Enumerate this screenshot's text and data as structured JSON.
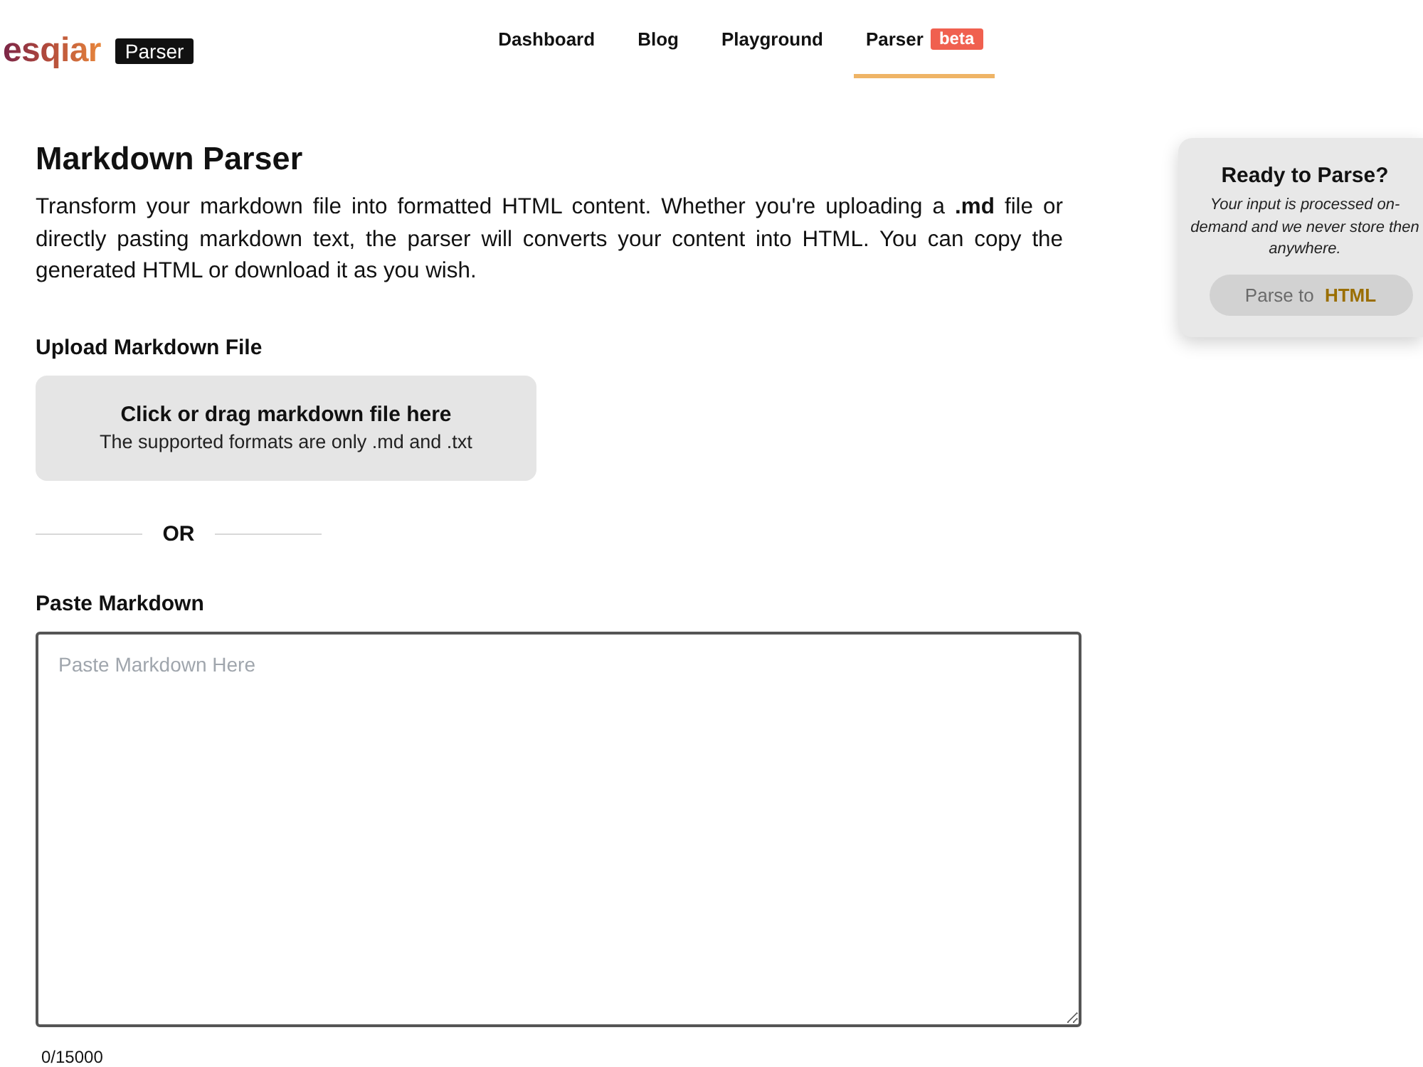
{
  "header": {
    "logo": "esqiar",
    "logo_tag": "Parser",
    "nav": [
      {
        "label": "Dashboard",
        "selected": false
      },
      {
        "label": "Blog",
        "selected": false
      },
      {
        "label": "Playground",
        "selected": false
      },
      {
        "label": "Parser",
        "selected": true,
        "badge": "beta"
      }
    ]
  },
  "main": {
    "title": "Markdown Parser",
    "description": "Transform your markdown file into formatted HTML content. Whether you're uploading a **.md** file or directly pasting markdown text, the parser will converts your content into HTML. You can copy the generated HTML or download it as you wish.",
    "upload": {
      "label": "Upload Markdown File",
      "title": "Click or drag markdown file here",
      "hint": "The supported formats are only .md and .txt"
    },
    "divider": "OR",
    "paste": {
      "label": "Paste Markdown",
      "placeholder": "Paste Markdown Here",
      "counter": "0/15000"
    }
  },
  "parse_card": {
    "title": "Ready to Parse?",
    "note": "Your input is processed on-demand and we never store then anywhere.",
    "button": {
      "label": "Parse to **HTML**",
      "disabled": true
    }
  }
}
